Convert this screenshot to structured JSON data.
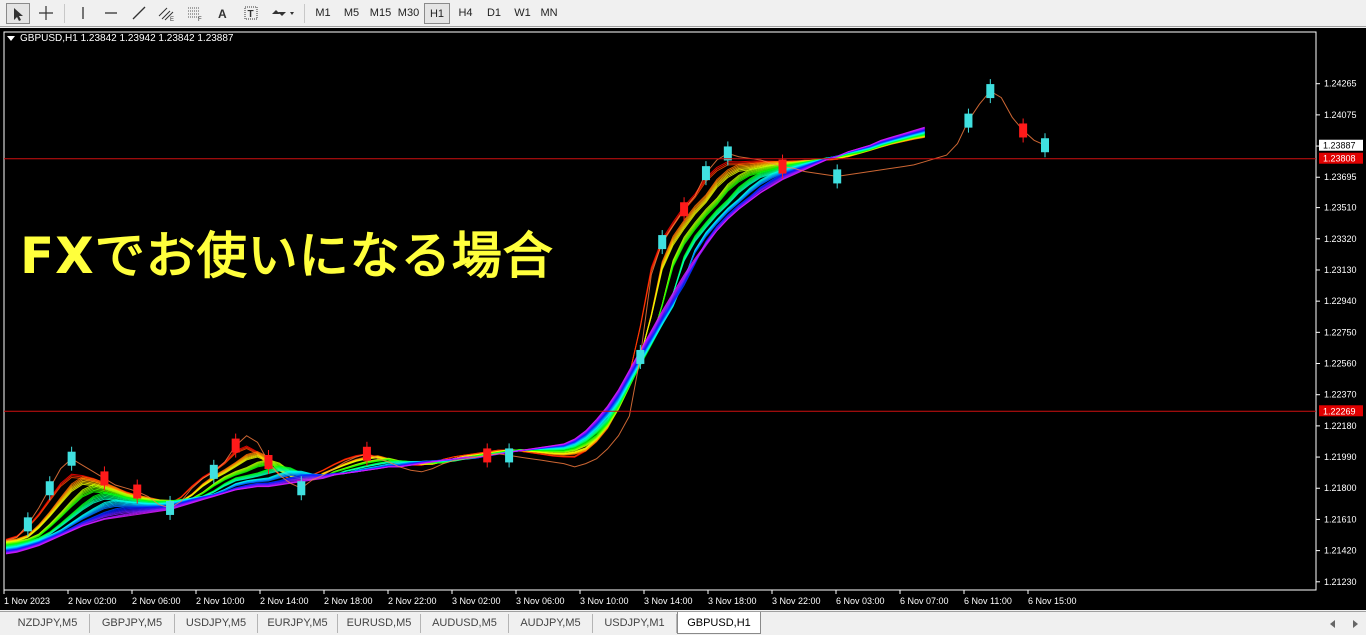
{
  "toolbar": {
    "drawing_tools": [
      {
        "name": "cursor-tool-button",
        "icon": "arrow-cursor-icon"
      },
      {
        "name": "crosshair-tool-button",
        "icon": "crosshair-icon"
      },
      {
        "name": "vertical-line-tool-button",
        "icon": "vertical-line-icon"
      },
      {
        "name": "horizontal-line-tool-button",
        "icon": "horizontal-line-icon"
      },
      {
        "name": "trendline-tool-button",
        "icon": "trendline-icon"
      },
      {
        "name": "equidistant-channel-tool-button",
        "icon": "channel-icon"
      },
      {
        "name": "fibonacci-tool-button",
        "icon": "fibonacci-icon"
      },
      {
        "name": "text-tool-button",
        "icon": "text-icon"
      },
      {
        "name": "text-label-tool-button",
        "icon": "text-label-icon"
      },
      {
        "name": "arrows-tool-button",
        "icon": "arrows-dropdown-icon"
      }
    ],
    "timeframes": [
      "M1",
      "M5",
      "M15",
      "M30",
      "H1",
      "H4",
      "D1",
      "W1",
      "MN"
    ],
    "active_timeframe": "H1"
  },
  "chart": {
    "symbol_line": "GBPUSD,H1  1.23842 1.23942 1.23842 1.23887",
    "overlay_text": "FXでお使いになる場合",
    "background": "#000000",
    "grid": false,
    "current_price_label": "1.23887",
    "upper_red_line_label": "1.23808",
    "lower_red_line_label": "1.22269",
    "colors": {
      "bull_candle": "#40e0e0",
      "bear_candle": "#ff1a1a",
      "hline": "#d01010",
      "overlay_text": "#ffff3c"
    }
  },
  "chart_data": {
    "type": "line",
    "title": "GBPUSD,H1",
    "xlabel": "",
    "ylabel": "",
    "y_ticks": [
      1.24265,
      1.24075,
      1.23885,
      1.23695,
      1.2351,
      1.2332,
      1.2313,
      1.2294,
      1.2275,
      1.2256,
      1.2237,
      1.2218,
      1.2199,
      1.218,
      1.2161,
      1.2142,
      1.2123
    ],
    "x_ticks": [
      "1 Nov 2023",
      "2 Nov 02:00",
      "2 Nov 06:00",
      "2 Nov 10:00",
      "2 Nov 14:00",
      "2 Nov 18:00",
      "2 Nov 22:00",
      "3 Nov 02:00",
      "3 Nov 06:00",
      "3 Nov 10:00",
      "3 Nov 14:00",
      "3 Nov 18:00",
      "3 Nov 22:00",
      "6 Nov 03:00",
      "6 Nov 07:00",
      "6 Nov 11:00",
      "6 Nov 15:00"
    ],
    "ylim": [
      1.2118,
      1.2458
    ],
    "price": [
      1.2148,
      1.215,
      1.2158,
      1.2168,
      1.218,
      1.2192,
      1.2198,
      1.2194,
      1.219,
      1.2186,
      1.2182,
      1.218,
      1.2178,
      1.2175,
      1.217,
      1.2168,
      1.2172,
      1.218,
      1.2186,
      1.219,
      1.2196,
      1.2206,
      1.2212,
      1.2208,
      1.2196,
      1.2188,
      1.2183,
      1.218,
      1.2185,
      1.2188,
      1.2192,
      1.2196,
      1.2199,
      1.2201,
      1.2198,
      1.2196,
      1.2193,
      1.2191,
      1.219,
      1.2192,
      1.2195,
      1.2197,
      1.2198,
      1.2199,
      1.22,
      1.2201,
      1.22,
      1.2199,
      1.2198,
      1.2197,
      1.2196,
      1.2195,
      1.2193,
      1.2195,
      1.2198,
      1.2204,
      1.2212,
      1.2224,
      1.226,
      1.231,
      1.233,
      1.234,
      1.235,
      1.2358,
      1.2372,
      1.238,
      1.2384,
      1.2382,
      1.2381,
      1.238,
      1.2378,
      1.2376,
      1.2375,
      1.2373,
      1.2372,
      1.2371,
      1.237,
      1.2371,
      1.2372,
      1.2373,
      1.2374,
      1.2375,
      1.2376,
      1.2377,
      1.2379,
      1.2381,
      1.2383,
      1.239,
      1.2404,
      1.2414,
      1.2422,
      1.2418,
      1.2406,
      1.2398,
      1.2392,
      1.2389
    ],
    "series": [
      {
        "values": [
          1.215,
          1.2152,
          1.2155,
          1.216,
          1.2166,
          1.2172,
          1.2177,
          1.218,
          1.2181,
          1.218,
          1.2178,
          1.2175,
          1.2173,
          1.2172,
          1.2172,
          1.2174,
          1.2178,
          1.2183,
          1.2188,
          1.2192,
          1.2196,
          1.2199,
          1.2198,
          1.2195,
          1.2192,
          1.219,
          1.2189,
          1.219,
          1.2192,
          1.2195,
          1.2198,
          1.22,
          1.2201,
          1.2201,
          1.22,
          1.2199,
          1.2198,
          1.2198,
          1.2199,
          1.22,
          1.2201,
          1.2202,
          1.2203,
          1.2204,
          1.2205,
          1.2206,
          1.2207,
          1.2207,
          1.2206,
          1.2205,
          1.2204,
          1.2204,
          1.2206,
          1.2212,
          1.2222,
          1.2236,
          1.2256,
          1.228,
          1.2302,
          1.232,
          1.2334,
          1.2345,
          1.2354,
          1.2361,
          1.2366,
          1.237,
          1.2373,
          1.2375,
          1.2377,
          1.2379,
          1.2381,
          1.2383,
          1.2385,
          1.2387,
          1.2389,
          1.2391,
          1.2393,
          1.2396,
          1.2399,
          1.2402,
          1.2405,
          1.2408,
          1.241,
          1.2412,
          1.2413
        ]
      },
      {
        "values": [
          1.214,
          1.2141,
          1.2143,
          1.2145,
          1.2148,
          1.2151,
          1.2154,
          1.2157,
          1.2159,
          1.2161,
          1.2162,
          1.2163,
          1.2164,
          1.2165,
          1.2166,
          1.2167,
          1.2169,
          1.2171,
          1.2173,
          1.2175,
          1.2177,
          1.2179,
          1.218,
          1.2181,
          1.2181,
          1.2182,
          1.2183,
          1.2184,
          1.2185,
          1.2186,
          1.2188,
          1.2189,
          1.219,
          1.2191,
          1.2192,
          1.2193,
          1.2193,
          1.2194,
          1.2195,
          1.2196,
          1.2197,
          1.2198,
          1.2199,
          1.2199,
          1.22,
          1.2201,
          1.2202,
          1.2203,
          1.2204,
          1.2205,
          1.2206,
          1.2207,
          1.221,
          1.2215,
          1.2222,
          1.223,
          1.224,
          1.2252,
          1.2264,
          1.2276,
          1.2288,
          1.2299,
          1.231,
          1.232,
          1.2329,
          1.2337,
          1.2344,
          1.235,
          1.2355,
          1.236,
          1.2364,
          1.2368,
          1.2371,
          1.2374,
          1.2377,
          1.238,
          1.2382,
          1.2385,
          1.2387,
          1.2389,
          1.2392,
          1.2394,
          1.2396,
          1.2398,
          1.24
        ]
      }
    ],
    "candles": [
      {
        "i": 2,
        "dir": "up"
      },
      {
        "i": 4,
        "dir": "up"
      },
      {
        "i": 6,
        "dir": "up"
      },
      {
        "i": 9,
        "dir": "down"
      },
      {
        "i": 12,
        "dir": "down"
      },
      {
        "i": 15,
        "dir": "up"
      },
      {
        "i": 19,
        "dir": "up"
      },
      {
        "i": 21,
        "dir": "down"
      },
      {
        "i": 24,
        "dir": "down"
      },
      {
        "i": 27,
        "dir": "up"
      },
      {
        "i": 33,
        "dir": "down"
      },
      {
        "i": 44,
        "dir": "down"
      },
      {
        "i": 46,
        "dir": "up"
      },
      {
        "i": 58,
        "dir": "up"
      },
      {
        "i": 60,
        "dir": "up"
      },
      {
        "i": 62,
        "dir": "down"
      },
      {
        "i": 64,
        "dir": "up"
      },
      {
        "i": 66,
        "dir": "up"
      },
      {
        "i": 71,
        "dir": "down"
      },
      {
        "i": 76,
        "dir": "up"
      },
      {
        "i": 88,
        "dir": "up"
      },
      {
        "i": 90,
        "dir": "up"
      },
      {
        "i": 93,
        "dir": "down"
      },
      {
        "i": 95,
        "dir": "up"
      }
    ]
  },
  "tabs": {
    "items": [
      "NZDJPY,M5",
      "GBPJPY,M5",
      "USDJPY,M5",
      "EURJPY,M5",
      "EURUSD,M5",
      "AUDUSD,M5",
      "AUDJPY,M5",
      "USDJPY,M1",
      "GBPUSD,H1"
    ],
    "active": "GBPUSD,H1"
  }
}
